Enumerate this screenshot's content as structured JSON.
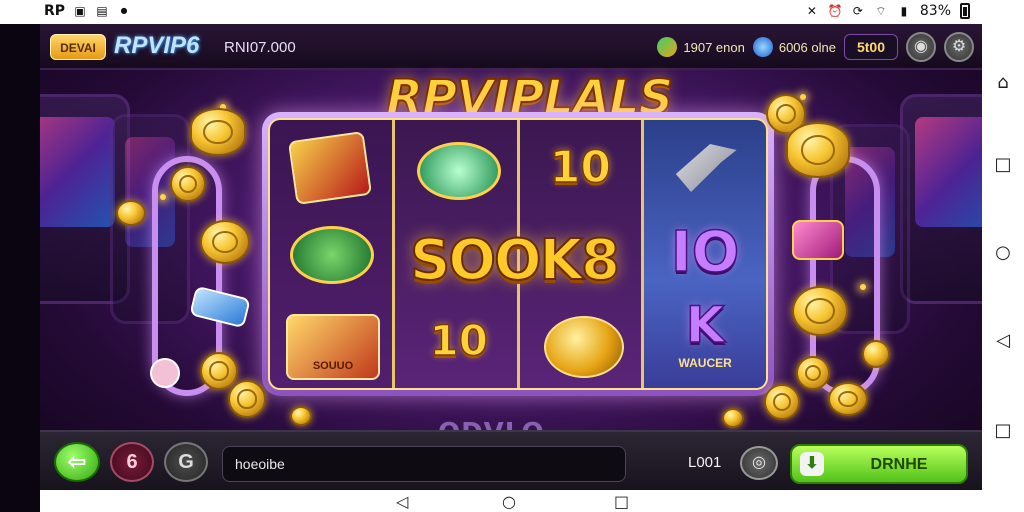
{
  "status_bar": {
    "app_label": "RP",
    "notif_icons": [
      "gallery-icon",
      "image-icon",
      "dot-icon"
    ],
    "battery_text": "83%",
    "right_icons": [
      "mute-icon",
      "alarm-icon",
      "data-icon",
      "wifi-icon",
      "signal-icon"
    ]
  },
  "game": {
    "menu_label": "DEVAI",
    "brand": "RPVIP6",
    "balance": "RNI07.000",
    "top_right": {
      "chip1": "1907 enon",
      "chip2": "6006 olne",
      "price": "5t00"
    },
    "title": "RPVIPLALS",
    "big_word": "SOOK8",
    "reels": {
      "r3_top": "10",
      "r3_bot": "10",
      "r4_mid": "IO",
      "r4_k": "K",
      "r4_bottom_label": "WAUCER",
      "r1_bottom_label": "SOUUO"
    },
    "under_text": "ODVLO"
  },
  "controls": {
    "back_icon": "arrow-left-icon",
    "red_btn": "6",
    "grey_btn": "G",
    "input_value": "hoeoibe",
    "value": "L001",
    "play_label": "DRNHE"
  },
  "colors": {
    "accent_gold": "#ffd23a",
    "purple_bg": "#4b1a6e",
    "play_green": "#52c21a"
  }
}
